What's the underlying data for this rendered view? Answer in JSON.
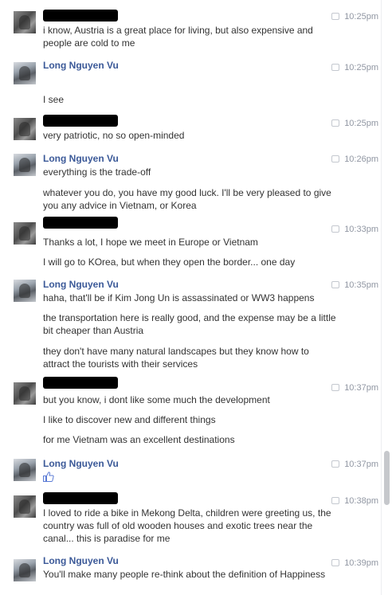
{
  "conversation": {
    "messages": [
      {
        "author": "",
        "redacted": true,
        "time": "10:25pm",
        "lines": [
          "i know, Austria is a great place for living, but also expensive and people are cold to me"
        ]
      },
      {
        "author": "Long Nguyen Vu",
        "redacted": false,
        "time": "10:25pm",
        "lines": [
          "I see"
        ]
      },
      {
        "author": "",
        "redacted": true,
        "time": "10:25pm",
        "lines": [
          "very patriotic, no so open-minded"
        ]
      },
      {
        "author": "Long Nguyen Vu",
        "redacted": false,
        "time": "10:26pm",
        "lines": [
          "everything is the trade-off",
          "whatever you do, you have my good luck. I'll be very pleased to give you any advice in Vietnam, or Korea"
        ]
      },
      {
        "author": "",
        "redacted": true,
        "time": "10:33pm",
        "lines": [
          "Thanks a lot, I hope we meet in Europe or Vietnam",
          "I will go to KOrea, but when they open the border... one day"
        ]
      },
      {
        "author": "Long Nguyen Vu",
        "redacted": false,
        "time": "10:35pm",
        "lines": [
          "haha, that'll be if Kim Jong Un is assassinated or WW3 happens",
          "the transportation here is really good, and the expense may be a little bit cheaper than Austria",
          "they don't have many natural landscapes but they know how to attract the tourists  with their services"
        ]
      },
      {
        "author": "",
        "redacted": true,
        "time": "10:37pm",
        "lines": [
          "but you know, i dont like some much the development",
          "I like to discover new and different things",
          "for me Vietnam was an excellent destinations"
        ]
      },
      {
        "author": "Long Nguyen Vu",
        "redacted": false,
        "time": "10:37pm",
        "lines": [],
        "like_icon": "thumbs-up-icon"
      },
      {
        "author": "",
        "redacted": true,
        "time": "10:38pm",
        "lines": [
          "I loved to ride a bike in Mekong Delta, children were greeting us, the country was full of old wooden houses and exotic trees near the canal... this is paradise for me"
        ]
      },
      {
        "author": "Long Nguyen Vu",
        "redacted": false,
        "time": "10:39pm",
        "lines": [
          "You'll make many people re-think about the definition of Happiness"
        ]
      }
    ]
  },
  "colors": {
    "name": "#3b5998",
    "time": "#9197a3",
    "text": "#333333",
    "like": "#5b7bd5"
  }
}
